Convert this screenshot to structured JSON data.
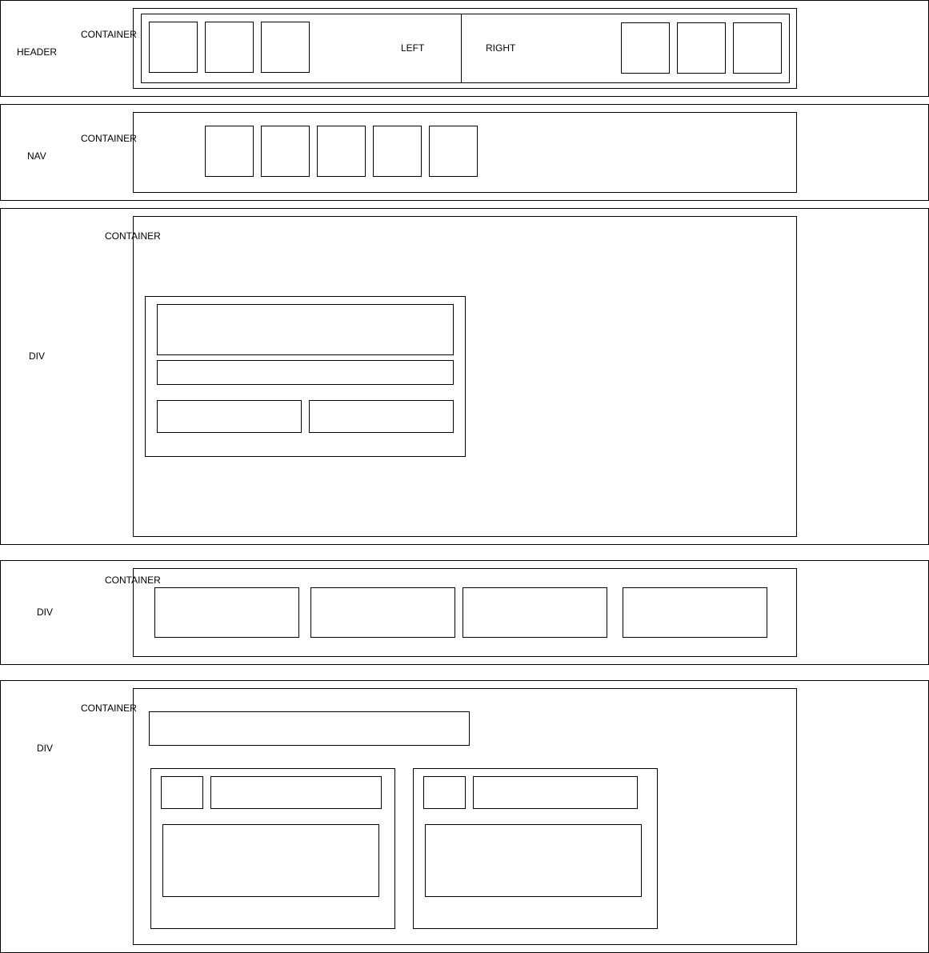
{
  "sections": {
    "header": {
      "label": "HEADER",
      "container_label": "CONTAINER",
      "left_label": "LEFT",
      "right_label": "RIGHT"
    },
    "nav": {
      "label": "NAV",
      "container_label": "CONTAINER"
    },
    "div1": {
      "label": "DIV",
      "container_label": "CONTAINER"
    },
    "div2": {
      "label": "DIV",
      "container_label": "CONTAINER"
    },
    "div3": {
      "label": "DIV",
      "container_label": "CONTAINER"
    }
  }
}
